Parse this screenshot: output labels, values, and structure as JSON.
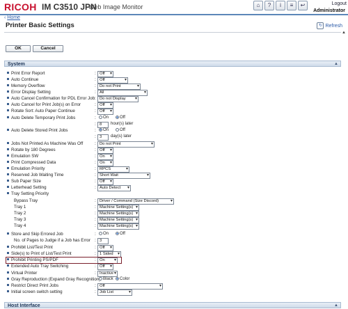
{
  "header": {
    "brand": "RICOH",
    "model": "IM C3510 JPN",
    "product": "Web Image Monitor",
    "icons": [
      "home-icon",
      "help-icon",
      "info-icon",
      "settings-icon",
      "logout-icon"
    ],
    "icon_glyphs": [
      "⌂",
      "?",
      "i",
      "≡",
      "↩"
    ],
    "logout": "Logout",
    "user": "Administrator"
  },
  "breadcrumb": {
    "home": "Home"
  },
  "page": {
    "title": "Printer Basic Settings",
    "refresh": "Refresh"
  },
  "buttons": {
    "ok": "OK",
    "cancel": "Cancel"
  },
  "sections": {
    "system": "System",
    "host_interface": "Host Interface"
  },
  "system_rows": [
    {
      "label": "Print Error Report",
      "type": "select",
      "value": "Off"
    },
    {
      "label": "Auto Continue",
      "type": "select",
      "value": "Off"
    },
    {
      "label": "Memory Overflow",
      "type": "select",
      "value": "Do not Print"
    },
    {
      "label": "Error Display Setting",
      "type": "select",
      "value": "All"
    },
    {
      "label": "Auto Cancel Confirmation for PDL Error Job",
      "type": "select",
      "value": "Do not Display"
    },
    {
      "label": "Auto Cancel for Print Job(s) on Error",
      "type": "select",
      "value": "Off"
    },
    {
      "label": "Rotate Sort: Auto Paper Continue",
      "type": "select",
      "value": "Off"
    },
    {
      "label": "Auto Delete Temporary Print Jobs",
      "type": "radio",
      "options": [
        "On",
        "Off"
      ],
      "selected": "Off"
    },
    {
      "label": "",
      "type": "text",
      "value": "8",
      "unit": "hour(s) later"
    },
    {
      "label": "Auto Delete Stored Print Jobs",
      "type": "radio",
      "options": [
        "On",
        "Off"
      ],
      "selected": "On"
    },
    {
      "label": "",
      "type": "text",
      "value": "3",
      "unit": "day(s) later"
    },
    {
      "label": "Jobs Not Printed As Machine Was Off",
      "type": "select",
      "value": "Do not Print"
    },
    {
      "label": "Rotate by 180 Degrees",
      "type": "select",
      "value": "Off"
    },
    {
      "label": "Emulation SW",
      "type": "select",
      "value": "On"
    },
    {
      "label": "Print Compressed Data",
      "type": "select",
      "value": "On"
    },
    {
      "label": "Emulation Priority",
      "type": "select",
      "value": "RPCS"
    },
    {
      "label": "Reserved Job Waiting Time",
      "type": "select",
      "value": "Short Wait"
    },
    {
      "label": "Sub Paper Size",
      "type": "select",
      "value": "Off"
    },
    {
      "label": "Letterhead Setting",
      "type": "select",
      "value": "Auto Detect"
    },
    {
      "label": "Tray Setting Priority",
      "type": "heading"
    },
    {
      "label": "Bypass Tray",
      "type": "select",
      "sub": true,
      "value": "Driver / Command (Size Discord)"
    },
    {
      "label": "Tray 1",
      "type": "select",
      "sub": true,
      "value": "Machine Setting(s)"
    },
    {
      "label": "Tray 2",
      "type": "select",
      "sub": true,
      "value": "Machine Setting(s)"
    },
    {
      "label": "Tray 3",
      "type": "select",
      "sub": true,
      "value": "Machine Setting(s)"
    },
    {
      "label": "Tray 4",
      "type": "select",
      "sub": true,
      "value": "Machine Setting(s)"
    },
    {
      "label": "Store and Skip Errored Job",
      "type": "radio",
      "options": [
        "On",
        "Off"
      ],
      "selected": "Off"
    },
    {
      "label": "No. of Pages to Judge if a Job has Error",
      "type": "text",
      "sub": true,
      "value": "3"
    },
    {
      "label": "Prohibit List/Test Print",
      "type": "select",
      "value": "Off"
    },
    {
      "label": "Side(s) to Print of List/Test Print",
      "type": "select",
      "value": "1 Sided"
    },
    {
      "label": "Prohibit Printing PS/PDF",
      "type": "select",
      "value": "On"
    },
    {
      "label": "Extended Auto Tray Switching",
      "type": "select",
      "value": "Off"
    },
    {
      "label": "Virtual Printer",
      "type": "select",
      "value": "Inactive"
    },
    {
      "label": "Gray Reproduction (Expand Gray Recognition)",
      "type": "radio",
      "options": [
        "Black",
        "Color"
      ],
      "selected": "Color"
    },
    {
      "label": "Restrict Direct Print Jobs",
      "type": "select",
      "value": "Off"
    },
    {
      "label": "Initial screen switch setting",
      "type": "select",
      "value": "Job List"
    }
  ],
  "colors": {
    "brand": "#c8102e",
    "accent": "#5b86b8",
    "highlight": "#7a1e2a",
    "link": "#2a5aa8"
  }
}
